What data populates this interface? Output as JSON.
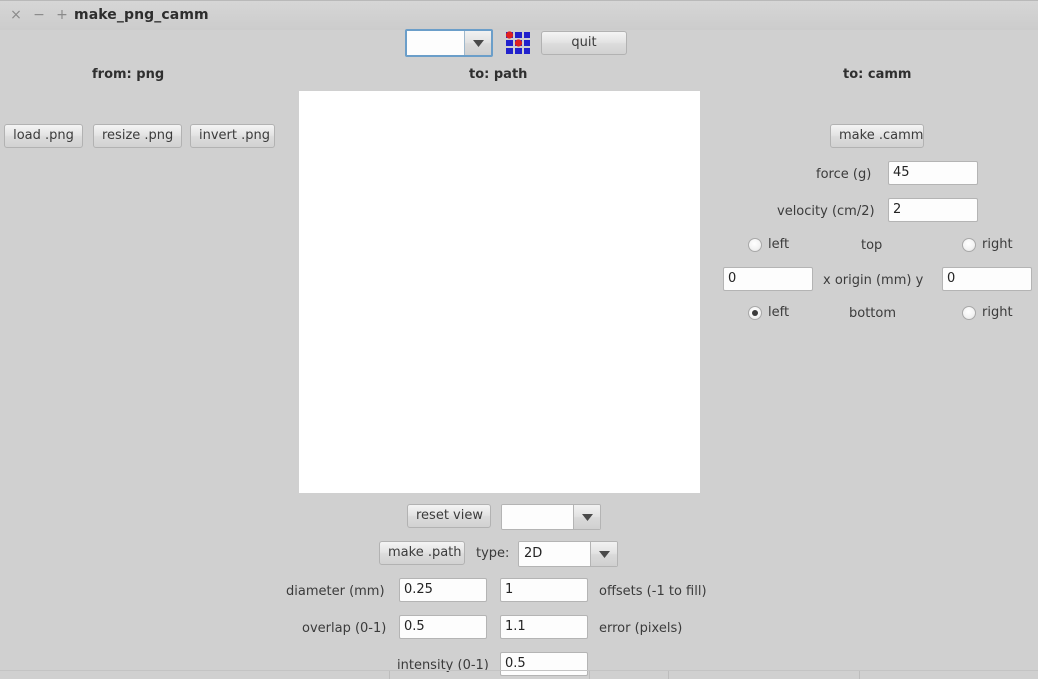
{
  "window": {
    "title": "make_png_camm",
    "controls": {
      "close": "×",
      "minimize": "−",
      "maximize": "+"
    },
    "background_color": "#d0d0d0"
  },
  "toolbar": {
    "file_combo_value": "",
    "grid_icon": "dither-grid-icon",
    "grid_icon_square_color": "#2222cc",
    "grid_icon_dot_color": "#e02020",
    "quit_label": "quit"
  },
  "columns": {
    "png": {
      "heading": "from: png",
      "buttons": [
        {
          "label": "load .png",
          "name": "load-png-button"
        },
        {
          "label": "resize .png",
          "name": "resize-png-button"
        },
        {
          "label": "invert .png",
          "name": "invert-png-button"
        }
      ]
    },
    "path": {
      "heading": "to: path",
      "canvas_color": "#ffffff",
      "reset_view_label": "reset view",
      "view_combo_value": "",
      "make_path_label": "make .path",
      "type_label": "type:",
      "type_value": "2D",
      "params": {
        "diameter_label": "diameter (mm)",
        "diameter_value": "0.25",
        "offsets_value": "1",
        "offsets_label": "offsets (-1 to fill)",
        "overlap_label": "overlap (0-1)",
        "overlap_value": "0.5",
        "error_value": "1.1",
        "error_label": "error (pixels)",
        "intensity_label": "intensity (0-1)",
        "intensity_value": "0.5"
      }
    },
    "camm": {
      "heading": "to: camm",
      "make_camm_label": "make .camm",
      "force_label": "force (g)",
      "force_value": "45",
      "velocity_label": "velocity (cm/2)",
      "velocity_value": "2",
      "origin": {
        "top_label": "top",
        "bottom_label": "bottom",
        "left_label": "left",
        "right_label": "right",
        "axis_label": "x origin (mm) y",
        "x_value": "0",
        "y_value": "0",
        "top_left_selected": false,
        "top_right_selected": false,
        "bottom_left_selected": true,
        "bottom_right_selected": false
      }
    }
  }
}
